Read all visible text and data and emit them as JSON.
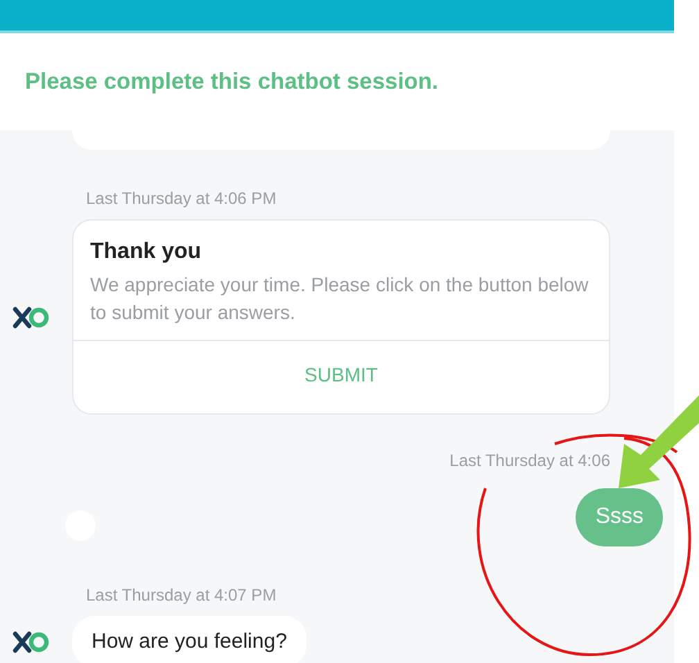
{
  "banner": {
    "title": "Please complete this chatbot session."
  },
  "messages": [
    {
      "kind": "card",
      "outgoing": false,
      "timestamp": "Last Thursday at 4:06 PM",
      "title": "Thank you",
      "body": "We appreciate your time. Please click on the button below to submit your answers.",
      "action": "SUBMIT"
    },
    {
      "kind": "bubble",
      "outgoing": true,
      "timestamp": "Last Thursday at 4:06",
      "text": "Ssss"
    },
    {
      "kind": "bubble",
      "outgoing": false,
      "timestamp": "Last Thursday at 4:07 PM",
      "text": "How are you feeling?"
    }
  ]
}
